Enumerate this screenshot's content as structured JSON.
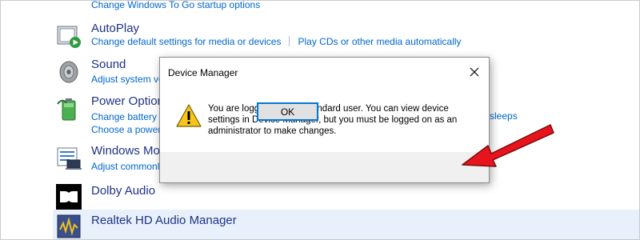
{
  "control_panel": {
    "top_link": "Change Windows To Go startup options",
    "items": [
      {
        "title": "AutoPlay",
        "links": [
          "Change default settings for media or devices",
          "Play CDs or other media automatically"
        ],
        "icon": "autoplay-icon"
      },
      {
        "title": "Sound",
        "links": [
          "Adjust system volume"
        ],
        "icon": "speaker-icon"
      },
      {
        "title": "Power Options",
        "links": [
          "Change battery settings",
          "Choose a power plan"
        ],
        "icon": "battery-icon"
      },
      {
        "title": "Windows Mobility Center",
        "links": [
          "Adjust commonly used mobility settings"
        ],
        "icon": "mobility-center-icon"
      },
      {
        "title": "Dolby Audio",
        "links": [],
        "icon": "dolby-icon"
      },
      {
        "title": "Realtek HD Audio Manager",
        "links": [],
        "icon": "realtek-icon"
      }
    ],
    "stray_link": "er sleeps"
  },
  "dialog": {
    "title": "Device Manager",
    "close_icon": "close-icon",
    "warning_icon": "warning-icon",
    "message": "You are logged on as a standard user. You can view device settings in Device Manager, but you must be logged on as an administrator to make changes.",
    "ok_label": "OK"
  },
  "annotation": {
    "arrow_color": "#e8141c",
    "arrow_icon": "red-arrow-icon"
  },
  "colors": {
    "link": "#0066cc",
    "item_title": "#1e3287",
    "selected_row": "#e8f1fb",
    "dialog_footer": "#f0f0f0",
    "ok_border": "#0078d7"
  }
}
